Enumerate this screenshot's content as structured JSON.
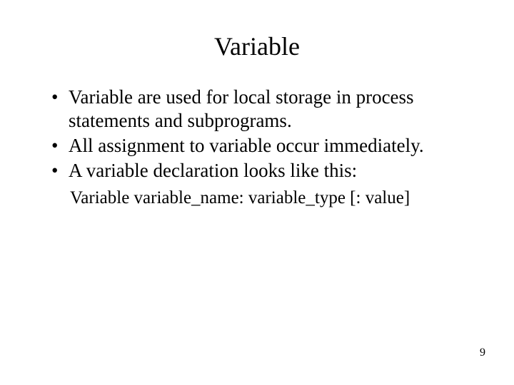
{
  "title": "Variable",
  "bullets": [
    "Variable are used for local storage in process statements and subprograms.",
    "All assignment to variable occur immediately.",
    "A variable declaration looks like this:"
  ],
  "codeLine": "Variable variable_name: variable_type [: value]",
  "pageNumber": "9"
}
